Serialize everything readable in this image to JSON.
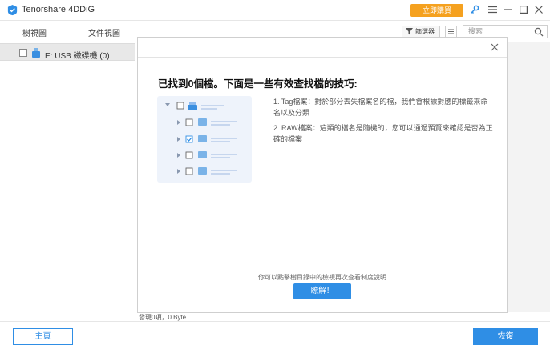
{
  "app": {
    "title": "Tenorshare 4DDiG",
    "buy_label": "立即購買"
  },
  "sidebar": {
    "tabs": [
      {
        "label": "樹視圖"
      },
      {
        "label": "文件視圖"
      }
    ],
    "tree_item": {
      "label": "E: USB 磁碟機 (0)"
    }
  },
  "toolbar": {
    "filter_label": "篩選器",
    "search_placeholder": "搜索"
  },
  "modal": {
    "title": "已找到0個檔。下面是一些有效查找檔的技巧:",
    "tip1": "1. Tag檔案：對於部分丟失檔案名的檔，我們會根據對應的標籤來命名以及分類",
    "tip2": "2. RAW檔案：這類的檔名是隨機的，您可以通過預覽來確認是否為正確的檔案",
    "hint": "你可以點擊樹目錄中的檢視再次查看制度說明",
    "ok_label": "瞭解！"
  },
  "status": {
    "text": "發現0項，0 Byte"
  },
  "footer": {
    "home_label": "主頁",
    "recover_label": "恢復"
  },
  "colors": {
    "accent": "#2f8ee5",
    "buy": "#f5a11f"
  }
}
